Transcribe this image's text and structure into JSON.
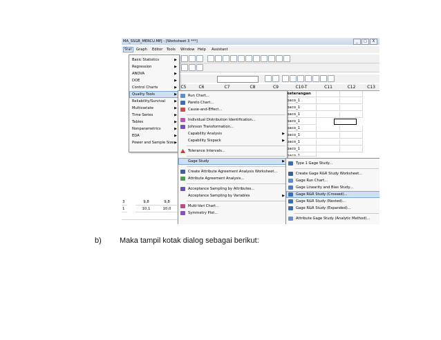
{
  "window": {
    "title": "MA_SSGB_MERCU.MPJ - [Worksheet 3 ***]",
    "btn_min": "_",
    "btn_max": "□",
    "btn_close": "X"
  },
  "menubar": [
    "Stat",
    "Graph",
    "Editor",
    "Tools",
    "Window",
    "Help",
    "Assistant"
  ],
  "stat_menu": [
    "Basic Statistics",
    "Regression",
    "ANOVA",
    "DOE",
    "Control Charts",
    "Quality Tools",
    "Reliability/Survival",
    "Multivariate",
    "Time Series",
    "Tables",
    "Nonparametrics",
    "EDA",
    "Power and Sample Size"
  ],
  "quality_menu": {
    "group1": [
      "Run Chart...",
      "Pareto Chart...",
      "Cause-and-Effect..."
    ],
    "group2": [
      "Individual Distribution Identification...",
      "Johnson Transformation...",
      "Capability Analysis",
      "Capability Sixpack"
    ],
    "group3": [
      "Tolerance Intervals..."
    ],
    "group4": [
      "Gage Study"
    ],
    "group5": [
      "Create Attribute Agreement Analysis Worksheet...",
      "Attribute Agreement Analysis..."
    ],
    "group6": [
      "Acceptance Sampling by Attributes...",
      "Acceptance Sampling by Variables"
    ],
    "group7": [
      "Multi-Vari Chart...",
      "Symmetry Plot..."
    ]
  },
  "gage_menu": [
    "Type 1 Gage Study...",
    "Create Gage R&R Study Worksheet...",
    "Gage Run Chart...",
    "Gage Linearity and Bias Study...",
    "Gage R&R Study (Crossed)...",
    "Gage R&R Study (Nested)...",
    "Gage R&R Study (Expanded)...",
    "Attribute Gage Study (Analytic Method)..."
  ],
  "columns": [
    "C5",
    "C6",
    "C7",
    "C8",
    "C9",
    "C10-T",
    "C11",
    "C12",
    "C13"
  ],
  "c10_header": "keterangan",
  "c10_values": [
    "baco_1",
    "baco_1",
    "baco_1",
    "baco_1",
    "baco_1",
    "baco_1",
    "baco_1",
    "baco_1",
    "baco_1"
  ],
  "left_rows": [
    {
      "row": "3",
      "a": "9,8",
      "b": "9,8"
    },
    {
      "row": "1",
      "a": "10,1",
      "b": "10,0"
    }
  ],
  "caption": {
    "label": "b)",
    "text": "Maka tampil kotak dialog sebagai berikut:"
  }
}
